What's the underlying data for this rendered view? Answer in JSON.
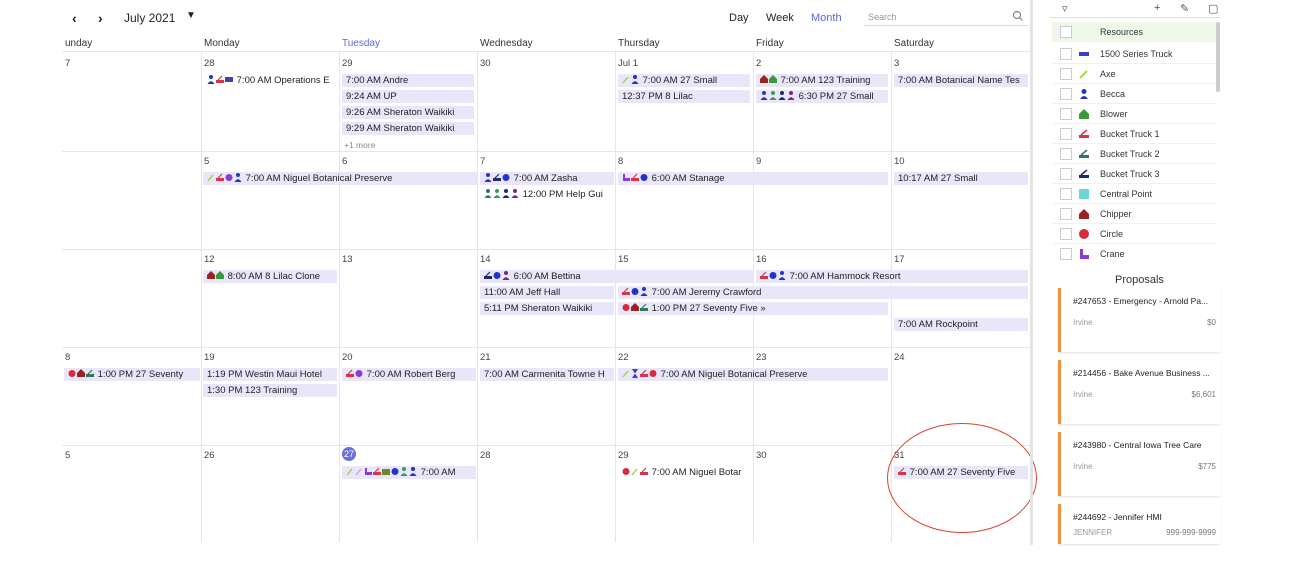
{
  "toolbar": {
    "prev": "‹",
    "next": "›",
    "month": "July 2021",
    "views": [
      "Day",
      "Week",
      "Month"
    ],
    "active_view": "Month",
    "search_placeholder": "Search"
  },
  "days_of_week": [
    "unday",
    "Monday",
    "Tuesday",
    "Wednesday",
    "Thursday",
    "Friday",
    "Saturday"
  ],
  "weeks": [
    [
      "7",
      "28",
      "29",
      "30",
      "Jul 1",
      "2",
      "3"
    ],
    [
      "",
      "5",
      "6",
      "7",
      "8",
      "9",
      "10"
    ],
    [
      "",
      "12",
      "13",
      "14",
      "15",
      "16",
      "17"
    ],
    [
      "8",
      "19",
      "20",
      "21",
      "22",
      "23",
      "24"
    ],
    [
      "5",
      "26",
      "27",
      "28",
      "29",
      "30",
      "31"
    ]
  ],
  "events": {
    "w0": [
      "7:00 AM Operations E",
      "7:00 AM Andre",
      "9:24 AM UP",
      "9:26 AM Sheraton Waikiki",
      "9:29 AM Sheraton Waikiki",
      "7:00 AM 27 Small",
      "12:37 PM 8 Lilac",
      "7:00 AM 123 Training",
      "6:30 PM 27 Small",
      "7:00 AM Botanical Name Tes"
    ],
    "w0_more": "+1 more",
    "w1": [
      "7:00 AM Niguel Botanical Preserve",
      "7:00 AM Zasha",
      "12:00 PM Help Gui",
      "6:00 AM Stanage",
      "10:17 AM 27 Small"
    ],
    "w2": [
      "8:00 AM 8 Lilac Clone",
      "6:00 AM Bettina",
      "7:00 AM Hammock Resort",
      "11:00 AM Jeff Hall",
      "7:00 AM Jeremy Crawford",
      "5:11 PM Sheraton Waikiki",
      "1:00 PM 27 Seventy Five",
      "7:00 AM Rockpoint"
    ],
    "w3": [
      "1:00 PM 27 Seventy",
      "1:19 PM Westin Maui Hotel",
      "1:30 PM 123 Training",
      "7:00 AM Robert Berg",
      "7:00 AM Carmenita Towne H",
      "7:00 AM Niguel Botanical Preserve"
    ],
    "w4": [
      "7:00 AM",
      "7:00 AM Niguel Botar",
      "7:00 AM 27 Seventy Five"
    ]
  },
  "resources": {
    "header": "Resources",
    "items": [
      {
        "label": "1500 Series Truck",
        "icon": "truck-icon",
        "color": "#3b3fc4"
      },
      {
        "label": "Axe",
        "icon": "axe-icon",
        "color": "#a6d64a"
      },
      {
        "label": "Becca",
        "icon": "person-icon",
        "color": "#2233cc"
      },
      {
        "label": "Blower",
        "icon": "blower-icon",
        "color": "#3a9a3a"
      },
      {
        "label": "Bucket Truck 1",
        "icon": "bucket-truck-icon",
        "color": "#d9334a"
      },
      {
        "label": "Bucket Truck 2",
        "icon": "bucket-truck-icon",
        "color": "#2a7a5a"
      },
      {
        "label": "Bucket Truck 3",
        "icon": "bucket-truck-icon",
        "color": "#1a2a6a"
      },
      {
        "label": "Central Point",
        "icon": "square-icon",
        "color": "#6bd6d6"
      },
      {
        "label": "Chipper",
        "icon": "chipper-icon",
        "color": "#9a2222"
      },
      {
        "label": "Circle",
        "icon": "circle-icon",
        "color": "#d92a3a"
      },
      {
        "label": "Crane",
        "icon": "crane-icon",
        "color": "#8a3ad6"
      }
    ]
  },
  "proposals": {
    "title": "Proposals",
    "items": [
      {
        "title": "#247653 - Emergency - Arnold Pa...",
        "city": "Irvine",
        "amount": "$0"
      },
      {
        "title": "#214456 - Bake Avenue Business ...",
        "city": "Irvine",
        "amount": "$6,601"
      },
      {
        "title": "#243980 - Central Iowa Tree Care",
        "city": "Irvine",
        "amount": "$775"
      },
      {
        "title": "#244692 - Jennifer HMI",
        "city": "JENNIFER",
        "amount": "999-999-9999"
      }
    ]
  },
  "colors": {
    "accent": "#5a67d8",
    "event_bg": "#e8e6f8",
    "proposal_border": "#f0943a",
    "highlight": "#d9442e"
  }
}
